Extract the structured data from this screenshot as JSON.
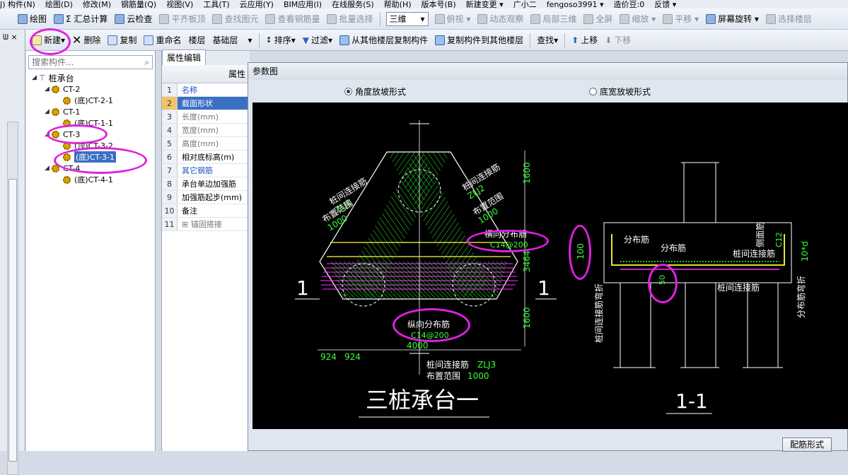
{
  "menubar": {
    "items": [
      "J) 构件(N)",
      "绘图(D)",
      "修改(M)",
      "钢筋量(Q)",
      "视图(V)",
      "工具(T)",
      "云应用(Y)",
      "BIM应用(I)",
      "在线服务(S)",
      "帮助(H)",
      "版本号(B)",
      "新建变更 ▾",
      "广小二",
      "fengoso3991 ▾",
      "造价豆:0",
      "反馈 ▾"
    ]
  },
  "toolbar1": {
    "items": [
      {
        "label": "绘图",
        "icon": "draw-icon",
        "disabled": false
      },
      {
        "label": "Σ 汇总计算",
        "icon": "sum-icon",
        "disabled": false
      },
      {
        "label": "云检查",
        "icon": "cloud-check-icon",
        "disabled": false
      },
      {
        "label": "平齐板顶",
        "icon": "align-top-icon",
        "disabled": true
      },
      {
        "label": "查找图元",
        "icon": "find-element-icon",
        "disabled": true
      },
      {
        "label": "查看钢筋量",
        "icon": "view-rebar-icon",
        "disabled": true
      },
      {
        "label": "批量选择",
        "icon": "batch-select-icon",
        "disabled": true
      }
    ],
    "view_combo": "三维",
    "items2": [
      {
        "label": "俯视 ▾",
        "icon": "top-view-icon",
        "disabled": true
      },
      {
        "label": "动态观察",
        "icon": "orbit-icon",
        "disabled": true
      },
      {
        "label": "局部三维",
        "icon": "local-3d-icon",
        "disabled": true
      },
      {
        "label": "全屏",
        "icon": "fullscreen-icon",
        "disabled": true
      },
      {
        "label": "缩放 ▾",
        "icon": "zoom-icon",
        "disabled": true
      },
      {
        "label": "平移 ▾",
        "icon": "pan-icon",
        "disabled": true
      },
      {
        "label": "屏幕旋转 ▾",
        "icon": "rotate-screen-icon",
        "disabled": false
      },
      {
        "label": "选择楼层",
        "icon": "select-floor-icon",
        "disabled": true
      }
    ]
  },
  "toolbar2": {
    "new_label": "新建▾",
    "delete_label": "删除",
    "copy_label": "复制",
    "rename_label": "重命名",
    "floor_label": "楼层",
    "floor_value": "基础层",
    "sort_label": "排序▾",
    "filter_label": "过滤▾",
    "copy_from_label": "从其他楼层复制构件",
    "copy_to_label": "复制构件到其他楼层",
    "find_label": "查找▾",
    "up_label": "上移",
    "down_label": "下移"
  },
  "tree": {
    "search_placeholder": "搜索构件...",
    "root": "桩承台",
    "nodes": [
      {
        "label": "CT-2",
        "level": 1,
        "selected": false
      },
      {
        "label": "(底)CT-2-1",
        "level": 2,
        "selected": false
      },
      {
        "label": "CT-1",
        "level": 1,
        "selected": false
      },
      {
        "label": "(底)CT-1-1",
        "level": 2,
        "selected": false
      },
      {
        "label": "CT-3",
        "level": 1,
        "selected": false
      },
      {
        "label": "(顶)CT-3-2",
        "level": 2,
        "selected": false
      },
      {
        "label": "(底)CT-3-1",
        "level": 2,
        "selected": true
      },
      {
        "label": "CT-4",
        "level": 1,
        "selected": false
      },
      {
        "label": "(底)CT-4-1",
        "level": 2,
        "selected": false
      }
    ]
  },
  "props": {
    "tab": "属性编辑",
    "header": "属性",
    "rows": [
      {
        "num": "1",
        "name": "名称",
        "style": "blue"
      },
      {
        "num": "2",
        "name": "截面形状",
        "style": "sel"
      },
      {
        "num": "3",
        "name": "长度(mm)",
        "style": "gray"
      },
      {
        "num": "4",
        "name": "宽度(mm)",
        "style": "gray"
      },
      {
        "num": "5",
        "name": "高度(mm)",
        "style": "gray"
      },
      {
        "num": "6",
        "name": "相对底标高(m)",
        "style": ""
      },
      {
        "num": "7",
        "name": "其它钢筋",
        "style": "blue"
      },
      {
        "num": "8",
        "name": "承台单边加强筋",
        "style": ""
      },
      {
        "num": "9",
        "name": "加强筋起步(mm)",
        "style": ""
      },
      {
        "num": "10",
        "name": "备注",
        "style": ""
      },
      {
        "num": "11",
        "name": "⊞ 锚固搭接",
        "style": "gray"
      }
    ]
  },
  "dialog": {
    "title": "参数图",
    "radio_angle": "角度放坡形式",
    "radio_width": "底宽放坡形式",
    "config_button": "配筋形式"
  },
  "drawing": {
    "plan_title": "三桩承台一",
    "section_title": "1-1",
    "section_mark": "1",
    "dim_1600": "1600",
    "dim_3464": "3464",
    "dim_4000": "4000",
    "dim_924": "924",
    "label_zlj1": "ZLJ1",
    "label_zlj2": "ZLJ2",
    "label_zlj3": "ZLJ3",
    "label_pile_link": "桩间连接筋",
    "label_range": "布置范围",
    "label_range_val": "1000",
    "label_hdist": "横向分布筋",
    "label_hdist_val": "C14@200",
    "label_vdist": "纵向分布筋",
    "label_vdist_val": "C14@200",
    "sec_dist": "分布筋",
    "sec_side": "侧面筋",
    "sec_link": "桩间连接筋",
    "sec_100": "100",
    "sec_50": "50",
    "sec_10d": "10*d",
    "sec_side_val": "C12",
    "sec_bend_left": "桩间连接筋弯折",
    "sec_bend_right": "分布筋弯折"
  },
  "colors": {
    "rebar_green": "#39ff39",
    "rebar_yellow": "#ffff33",
    "rebar_magenta": "#ff33ff",
    "line_white": "#ffffff",
    "annotation": "#e020e0"
  }
}
